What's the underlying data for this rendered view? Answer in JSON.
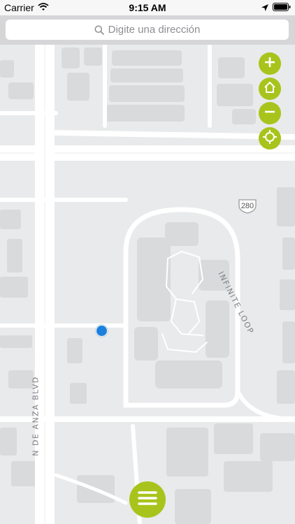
{
  "status_bar": {
    "carrier": "Carrier",
    "time": "9:15 AM",
    "icons": [
      "wifi-icon",
      "location-arrow-icon",
      "battery-icon"
    ]
  },
  "search": {
    "placeholder": "Digite una dirección",
    "icon": "search-icon"
  },
  "map": {
    "labels": {
      "road_left": "N DE ANZA BLVD",
      "road_loop": "INFINITE LOOP",
      "highway_shield": "280"
    },
    "controls": [
      {
        "name": "zoom-in",
        "icon": "plus-icon"
      },
      {
        "name": "home",
        "icon": "home-icon"
      },
      {
        "name": "zoom-out",
        "icon": "minus-icon"
      },
      {
        "name": "locate",
        "icon": "crosshair-icon"
      }
    ]
  },
  "menu": {
    "icon": "hamburger-menu-icon"
  },
  "colors": {
    "accent": "#a8c41c",
    "map_background": "#e9eaeb",
    "building": "#d8dadb",
    "road": "#ffffff",
    "location_dot": "#1b7fdd"
  }
}
